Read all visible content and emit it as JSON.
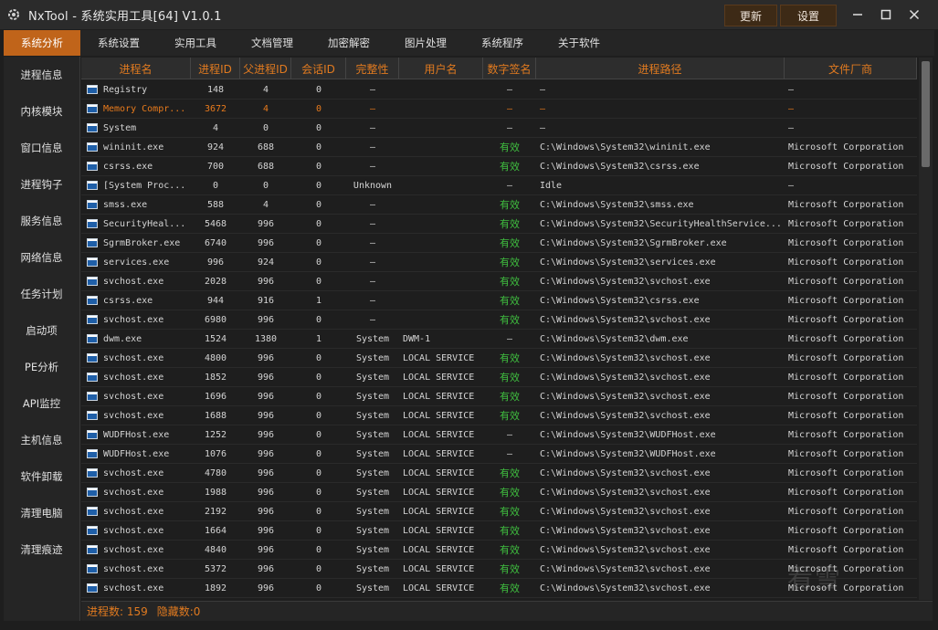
{
  "window": {
    "title": "NxTool - 系统实用工具[64] V1.0.1",
    "update_label": "更新",
    "settings_label": "设置",
    "logo_icon": "gear-logo-icon"
  },
  "menu": [
    {
      "label": "系统分析",
      "active": true
    },
    {
      "label": "系统设置",
      "active": false
    },
    {
      "label": "实用工具",
      "active": false
    },
    {
      "label": "文档管理",
      "active": false
    },
    {
      "label": "加密解密",
      "active": false
    },
    {
      "label": "图片处理",
      "active": false
    },
    {
      "label": "系统程序",
      "active": false
    },
    {
      "label": "关于软件",
      "active": false
    }
  ],
  "sidebar": [
    "进程信息",
    "内核模块",
    "窗口信息",
    "进程钩子",
    "服务信息",
    "网络信息",
    "任务计划",
    "启动项",
    "PE分析",
    "API监控",
    "主机信息",
    "软件卸载",
    "清理电脑",
    "清理痕迹"
  ],
  "table": {
    "headers": [
      "进程名",
      "进程ID",
      "父进程ID",
      "会话ID",
      "完整性",
      "用户名",
      "数字签名",
      "进程路径",
      "文件厂商"
    ],
    "rows": [
      [
        "Registry",
        "148",
        "4",
        "0",
        "—",
        "",
        "—",
        "—",
        "—"
      ],
      [
        "Memory Compr...",
        "3672",
        "4",
        "0",
        "—",
        "",
        "—",
        "—",
        "—"
      ],
      [
        "System",
        "4",
        "0",
        "0",
        "—",
        "",
        "—",
        "—",
        "—"
      ],
      [
        "wininit.exe",
        "924",
        "688",
        "0",
        "—",
        "",
        "有效",
        "C:\\Windows\\System32\\wininit.exe",
        "Microsoft Corporation"
      ],
      [
        "csrss.exe",
        "700",
        "688",
        "0",
        "—",
        "",
        "有效",
        "C:\\Windows\\System32\\csrss.exe",
        "Microsoft Corporation"
      ],
      [
        "[System Proc...",
        "0",
        "0",
        "0",
        "Unknown",
        "",
        "—",
        "Idle",
        "—"
      ],
      [
        "smss.exe",
        "588",
        "4",
        "0",
        "—",
        "",
        "有效",
        "C:\\Windows\\System32\\smss.exe",
        "Microsoft Corporation"
      ],
      [
        "SecurityHeal...",
        "5468",
        "996",
        "0",
        "—",
        "",
        "有效",
        "C:\\Windows\\System32\\SecurityHealthService...",
        "Microsoft Corporation"
      ],
      [
        "SgrmBroker.exe",
        "6740",
        "996",
        "0",
        "—",
        "",
        "有效",
        "C:\\Windows\\System32\\SgrmBroker.exe",
        "Microsoft Corporation"
      ],
      [
        "services.exe",
        "996",
        "924",
        "0",
        "—",
        "",
        "有效",
        "C:\\Windows\\System32\\services.exe",
        "Microsoft Corporation"
      ],
      [
        "svchost.exe",
        "2028",
        "996",
        "0",
        "—",
        "",
        "有效",
        "C:\\Windows\\System32\\svchost.exe",
        "Microsoft Corporation"
      ],
      [
        "csrss.exe",
        "944",
        "916",
        "1",
        "—",
        "",
        "有效",
        "C:\\Windows\\System32\\csrss.exe",
        "Microsoft Corporation"
      ],
      [
        "svchost.exe",
        "6980",
        "996",
        "0",
        "—",
        "",
        "有效",
        "C:\\Windows\\System32\\svchost.exe",
        "Microsoft Corporation"
      ],
      [
        "dwm.exe",
        "1524",
        "1380",
        "1",
        "System",
        "DWM-1",
        "—",
        "C:\\Windows\\System32\\dwm.exe",
        "Microsoft Corporation"
      ],
      [
        "svchost.exe",
        "4800",
        "996",
        "0",
        "System",
        "LOCAL SERVICE",
        "有效",
        "C:\\Windows\\System32\\svchost.exe",
        "Microsoft Corporation"
      ],
      [
        "svchost.exe",
        "1852",
        "996",
        "0",
        "System",
        "LOCAL SERVICE",
        "有效",
        "C:\\Windows\\System32\\svchost.exe",
        "Microsoft Corporation"
      ],
      [
        "svchost.exe",
        "1696",
        "996",
        "0",
        "System",
        "LOCAL SERVICE",
        "有效",
        "C:\\Windows\\System32\\svchost.exe",
        "Microsoft Corporation"
      ],
      [
        "svchost.exe",
        "1688",
        "996",
        "0",
        "System",
        "LOCAL SERVICE",
        "有效",
        "C:\\Windows\\System32\\svchost.exe",
        "Microsoft Corporation"
      ],
      [
        "WUDFHost.exe",
        "1252",
        "996",
        "0",
        "System",
        "LOCAL SERVICE",
        "—",
        "C:\\Windows\\System32\\WUDFHost.exe",
        "Microsoft Corporation"
      ],
      [
        "WUDFHost.exe",
        "1076",
        "996",
        "0",
        "System",
        "LOCAL SERVICE",
        "—",
        "C:\\Windows\\System32\\WUDFHost.exe",
        "Microsoft Corporation"
      ],
      [
        "svchost.exe",
        "4780",
        "996",
        "0",
        "System",
        "LOCAL SERVICE",
        "有效",
        "C:\\Windows\\System32\\svchost.exe",
        "Microsoft Corporation"
      ],
      [
        "svchost.exe",
        "1988",
        "996",
        "0",
        "System",
        "LOCAL SERVICE",
        "有效",
        "C:\\Windows\\System32\\svchost.exe",
        "Microsoft Corporation"
      ],
      [
        "svchost.exe",
        "2192",
        "996",
        "0",
        "System",
        "LOCAL SERVICE",
        "有效",
        "C:\\Windows\\System32\\svchost.exe",
        "Microsoft Corporation"
      ],
      [
        "svchost.exe",
        "1664",
        "996",
        "0",
        "System",
        "LOCAL SERVICE",
        "有效",
        "C:\\Windows\\System32\\svchost.exe",
        "Microsoft Corporation"
      ],
      [
        "svchost.exe",
        "4840",
        "996",
        "0",
        "System",
        "LOCAL SERVICE",
        "有效",
        "C:\\Windows\\System32\\svchost.exe",
        "Microsoft Corporation"
      ],
      [
        "svchost.exe",
        "5372",
        "996",
        "0",
        "System",
        "LOCAL SERVICE",
        "有效",
        "C:\\Windows\\System32\\svchost.exe",
        "Microsoft Corporation"
      ],
      [
        "svchost.exe",
        "1892",
        "996",
        "0",
        "System",
        "LOCAL SERVICE",
        "有效",
        "C:\\Windows\\System32\\svchost.exe",
        "Microsoft Corporation"
      ]
    ],
    "highlighted_row": 1,
    "valid_text": "有效"
  },
  "status": {
    "process_count": "进程数: 159",
    "hidden_count": "隐藏数:0"
  },
  "watermark": "看雪",
  "colors": {
    "accent": "#c0641a",
    "header_text": "#e07a20",
    "valid": "#3fbf3f"
  }
}
